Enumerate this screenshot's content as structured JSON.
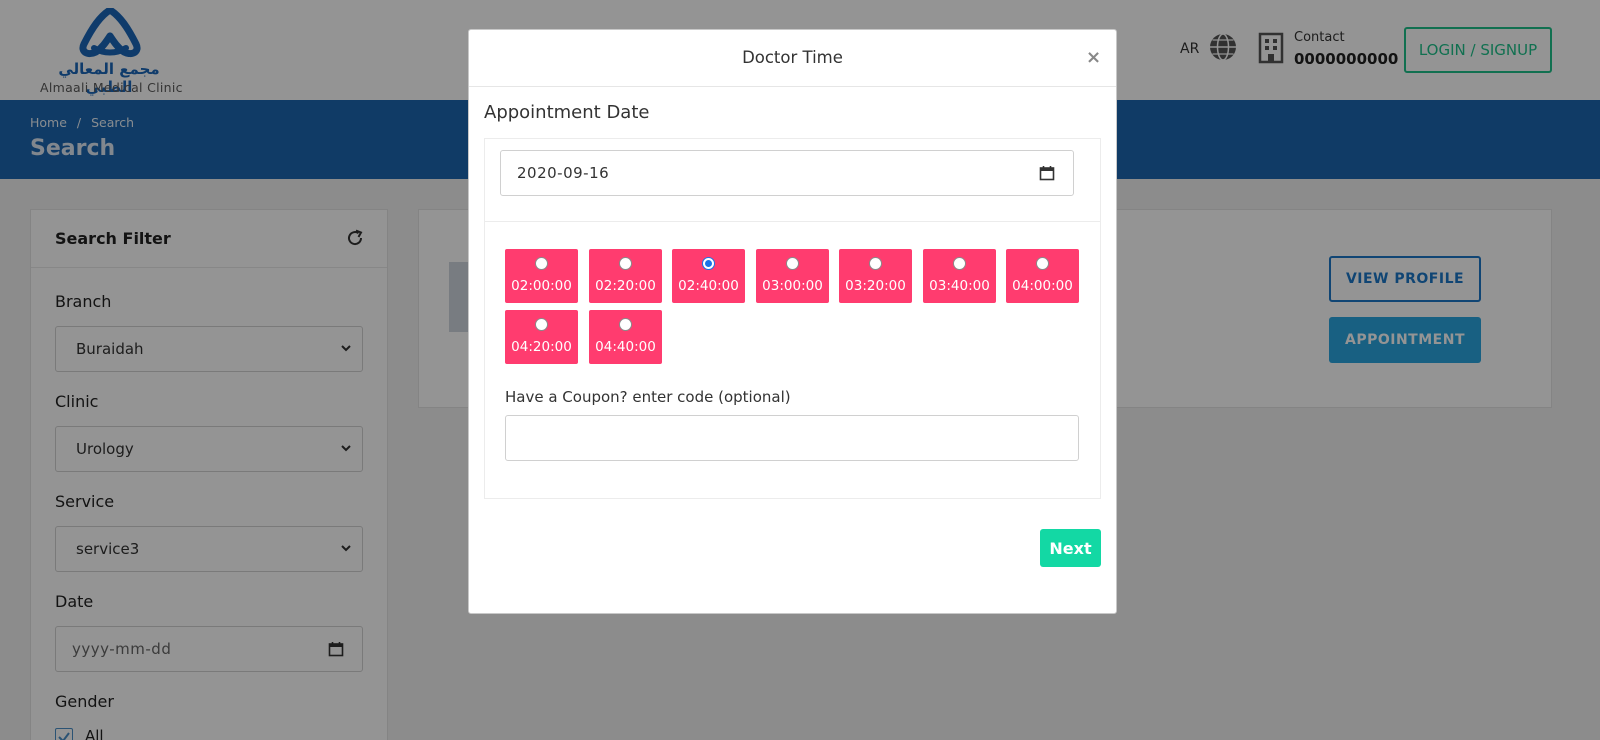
{
  "header": {
    "logo_ar": "مجمع المعالي الطبي",
    "logo_en": "Almaali Medical Clinic",
    "language_toggle": "AR",
    "contact_label": "Contact",
    "contact_phone": "0000000000",
    "login_label": "LOGIN / SIGNUP"
  },
  "banner": {
    "breadcrumb": [
      "Home",
      "/",
      "Search"
    ],
    "title": "Search"
  },
  "filter": {
    "title": "Search Filter",
    "branch_label": "Branch",
    "branch_value": "Buraidah",
    "clinic_label": "Clinic",
    "clinic_value": "Urology",
    "service_label": "Service",
    "service_value": "service3",
    "date_label": "Date",
    "date_placeholder": "yyyy-mm-dd",
    "gender_label": "Gender",
    "gender_option": "All",
    "gender_checked": true
  },
  "result": {
    "view_profile_label": "VIEW PROFILE",
    "appointment_label": "APPOINTMENT"
  },
  "modal": {
    "title": "Doctor Time",
    "close_symbol": "×",
    "appointment_date_label": "Appointment Date",
    "date_value": "2020-09-16",
    "time_slots": [
      {
        "time": "02:00:00",
        "selected": false
      },
      {
        "time": "02:20:00",
        "selected": false
      },
      {
        "time": "02:40:00",
        "selected": true
      },
      {
        "time": "03:00:00",
        "selected": false
      },
      {
        "time": "03:20:00",
        "selected": false
      },
      {
        "time": "03:40:00",
        "selected": false
      },
      {
        "time": "04:00:00",
        "selected": false
      },
      {
        "time": "04:20:00",
        "selected": false
      },
      {
        "time": "04:40:00",
        "selected": false
      }
    ],
    "coupon_label": "Have a Coupon? enter code (optional)",
    "coupon_value": "",
    "next_label": "Next"
  },
  "colors": {
    "brand_blue": "#1c67b0",
    "slot_pink": "#ff3c6f",
    "login_green": "#1ec28b",
    "next_green": "#13d8a4",
    "appointment_blue": "#2aa6e0"
  }
}
